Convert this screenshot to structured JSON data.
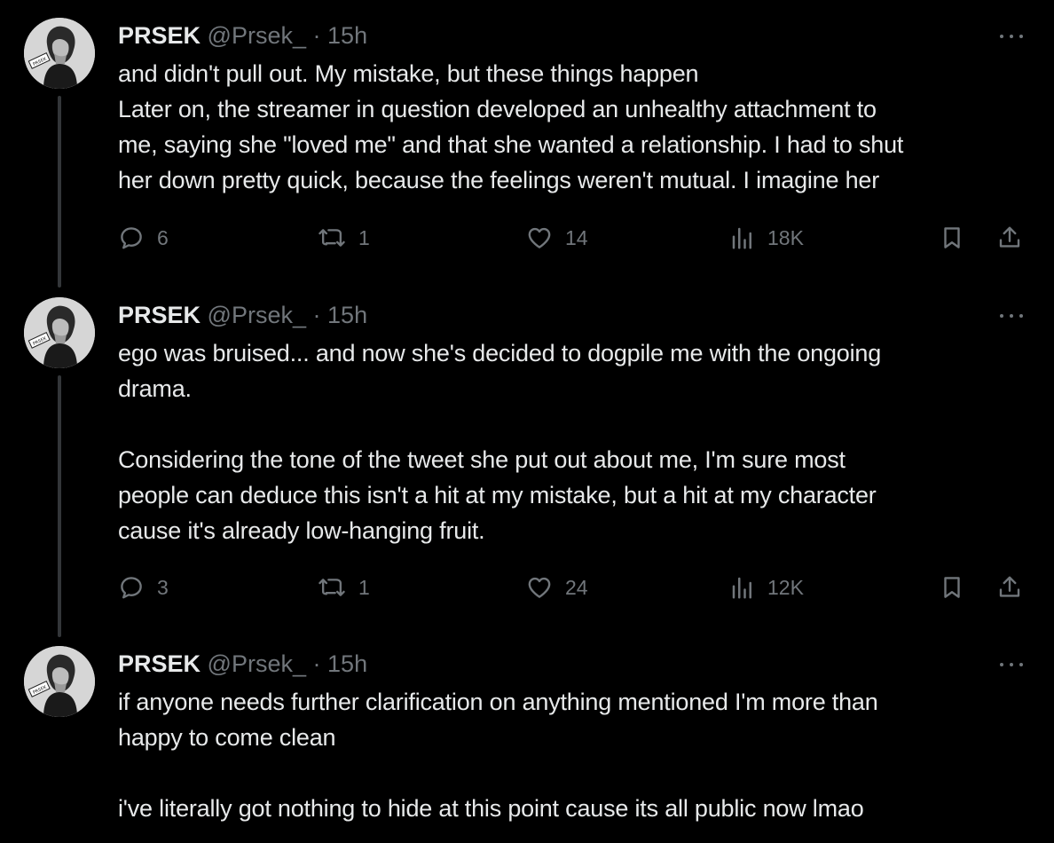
{
  "colors": {
    "background": "#000000",
    "text_primary": "#e7e9ea",
    "text_secondary": "#71767b",
    "thread_line": "#333639"
  },
  "icons": {
    "more": "more-icon",
    "reply": "reply-icon",
    "retweet": "retweet-icon",
    "like": "heart-icon",
    "views": "views-icon",
    "bookmark": "bookmark-icon",
    "share": "share-icon"
  },
  "tweets": [
    {
      "author": {
        "name": "PRSEK",
        "handle": "@Prsek_",
        "separator": "·",
        "time": "15h"
      },
      "lines": [
        "and didn't pull out. My mistake, but these things happen",
        "Later on, the streamer in question developed an unhealthy attachment to",
        "me, saying she \"loved me\" and that she wanted a relationship. I had to shut",
        "her down pretty quick, because the feelings weren't mutual. I imagine her"
      ],
      "stats": {
        "replies": "6",
        "retweets": "1",
        "likes": "14",
        "views": "18K"
      }
    },
    {
      "author": {
        "name": "PRSEK",
        "handle": "@Prsek_",
        "separator": "·",
        "time": "15h"
      },
      "lines": [
        "ego was bruised... and now she's decided to dogpile me with the ongoing",
        "drama.",
        "",
        "Considering the tone of the tweet she put out about me, I'm sure most",
        "people can deduce this isn't a hit at my mistake, but a hit at my character",
        "cause it's already low-hanging fruit."
      ],
      "stats": {
        "replies": "3",
        "retweets": "1",
        "likes": "24",
        "views": "12K"
      }
    },
    {
      "author": {
        "name": "PRSEK",
        "handle": "@Prsek_",
        "separator": "·",
        "time": "15h"
      },
      "lines": [
        "if anyone needs further clarification on anything mentioned I'm more than",
        "happy to come clean",
        "",
        "i've literally got nothing to hide at this point cause its all public now lmao"
      ]
    }
  ]
}
